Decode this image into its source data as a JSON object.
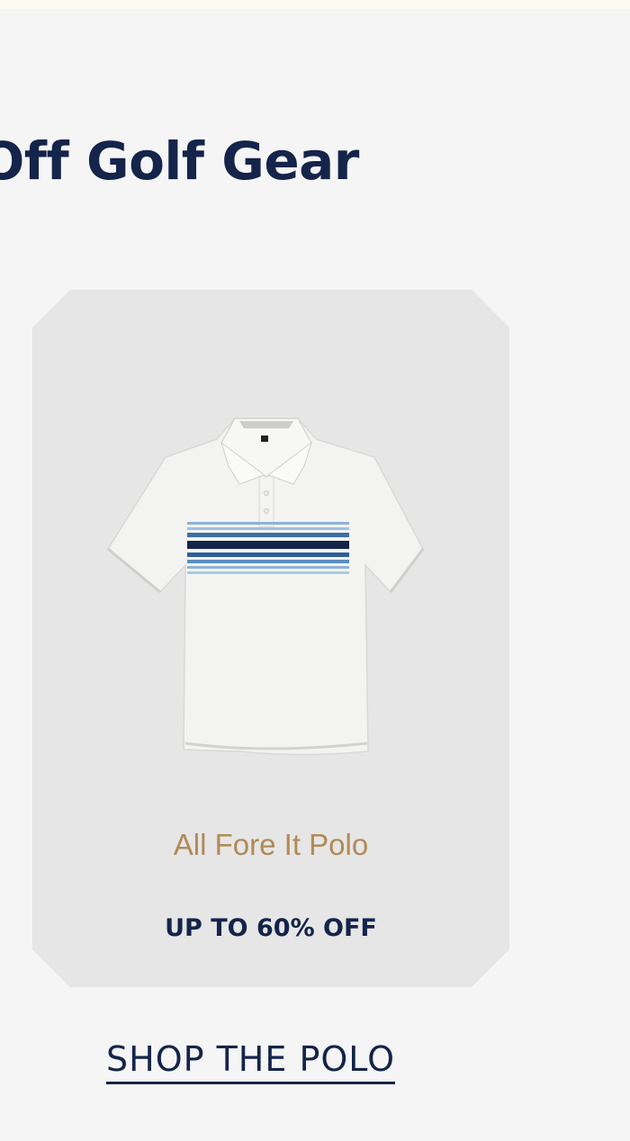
{
  "page": {
    "headline": "Off Golf Gear",
    "background_color": "#f5f5f6",
    "accent_color": "#14244a"
  },
  "product": {
    "name": "All Fore It Polo",
    "discount": "UP TO 60% OFF",
    "image_icon": "white-polo-shirt-with-blue-stripes",
    "name_color": "#b08a56"
  },
  "cta": {
    "label": "SHOP THE POLO"
  }
}
